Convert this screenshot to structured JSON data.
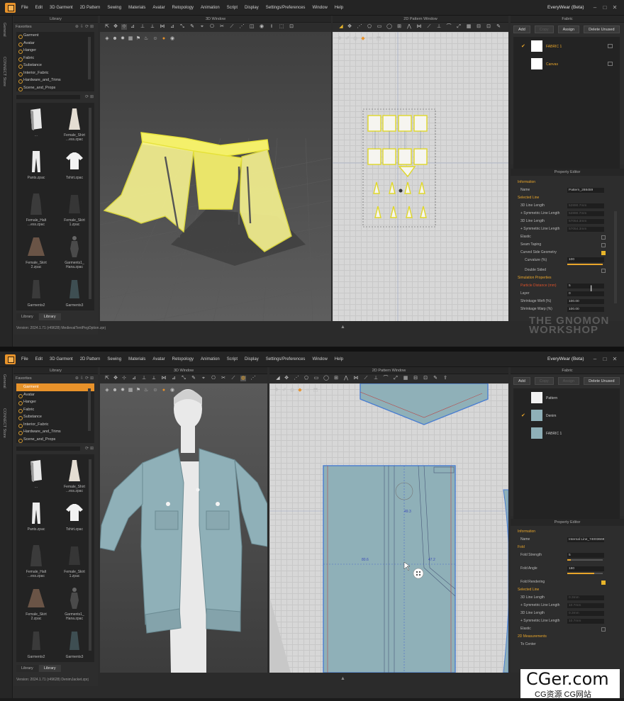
{
  "app": {
    "menu": [
      "File",
      "Edit",
      "3D Garment",
      "2D Pattern",
      "Sewing",
      "Materials",
      "Avatar",
      "Retopology",
      "Animation",
      "Script",
      "Display",
      "Settings/Preferences",
      "Window",
      "Help"
    ],
    "title": "EveryWear (Beta)",
    "side_tabs": [
      "General",
      "CONNECT Store"
    ]
  },
  "top": {
    "library_title": "Library",
    "favorites_label": "Favorites",
    "tree": [
      "Garment",
      "Avatar",
      "Hanger",
      "Fabric",
      "Substance",
      "Interior_Fabric",
      "Hardware_and_Trims",
      "Scene_and_Props"
    ],
    "items": [
      "...",
      "Female_Shirt\n...ess.zpac",
      "Pants.zpac",
      "Tshirt.zpac",
      "Female_Halt\n...ess.zpac",
      "Female_Skirt\n1.zpac",
      "Female_Skirt\n2.zpac",
      "Garments1_\nHana.zpac",
      "Garments2",
      "Garments3"
    ],
    "tabs": [
      "Library",
      "Library"
    ],
    "version": "Version: 2024.1.71 (r49628) MedievalTentPegOption.zprj",
    "window_3d_title": "3D Window",
    "window_2d_title": "2D Pattern Window",
    "fabric_title": "Fabric",
    "buttons": [
      "Add",
      "Copy",
      "Assign",
      "Delete Unused"
    ],
    "fabrics": [
      "FABRIC 1",
      "Canvas"
    ],
    "prop_title": "Property Editor",
    "props": [
      {
        "k": "Information",
        "sec": true
      },
      {
        "k": "Name",
        "v": "Pattern_288459"
      },
      {
        "k": "Selected Line",
        "sec": true
      },
      {
        "k": "3D Line Length",
        "v": "52890.7mm",
        "dim": true
      },
      {
        "k": "+ Symmetric Line Length",
        "v": "52890.7mm",
        "dim": true
      },
      {
        "k": "3D Line Length",
        "v": "57054.3mm",
        "dim": true
      },
      {
        "k": "+ Symmetric Line Length",
        "v": "57054.3mm",
        "dim": true
      },
      {
        "k": "Elastic",
        "cb": false
      },
      {
        "k": "Seam Taping",
        "cb": false
      },
      {
        "k": "Curved Side Geometry",
        "cb": true
      },
      {
        "k": "Curvature (%)",
        "v": "100",
        "slider": 100
      },
      {
        "k": "Double Sided",
        "cb": false
      },
      {
        "k": "Simulation Properties",
        "sec": true
      },
      {
        "k": "Particle Distance (mm)",
        "v": "5",
        "red": true
      },
      {
        "k": "Layer",
        "v": "0"
      },
      {
        "k": "Shrinkage Weft (%)",
        "v": "100.00"
      },
      {
        "k": "Shrinkage Warp (%)",
        "v": "100.00"
      }
    ],
    "watermark": "THE GNOMON WORKSHOP"
  },
  "bottom": {
    "library_title": "Library",
    "favorites_label": "Favorites",
    "tree": [
      "Garment",
      "Avatar",
      "Hanger",
      "Fabric",
      "Substance",
      "Interior_Fabric",
      "Hardware_and_Trims",
      "Scene_and_Props"
    ],
    "items": [
      "...",
      "Female_Shirt\n...ess.zpac",
      "Pants.zpac",
      "Tshirt.zpac",
      "Female_Halt\n...ess.zpac",
      "Female_Skirt\n1.zpac",
      "Female_Skirt\n2.zpac",
      "Garments1_\nHana.zpac",
      "Garments2",
      "Garments3"
    ],
    "tabs": [
      "Library",
      "Library"
    ],
    "version": "Version: 2024.1.71 (r49628) DenimJacket.zprj",
    "window_3d_title": "3D Window",
    "window_2d_title": "2D Pattern Window",
    "fabric_title": "Fabric",
    "buttons": [
      "Add",
      "Copy",
      "Assign",
      "Delete Unused"
    ],
    "fabrics": [
      "Pattern",
      "Denim",
      "FABRIC 1"
    ],
    "prop_title": "Property Editor",
    "props": [
      {
        "k": "Information",
        "sec": true
      },
      {
        "k": "Name",
        "v": "Internal Line_74003669"
      },
      {
        "k": "Fold",
        "sec": true
      },
      {
        "k": "Fold Strength",
        "v": "5",
        "slider": 10
      },
      {
        "k": "Fold Angle",
        "v": "180",
        "slider": 75
      },
      {
        "k": "Fold Rendering",
        "cb": true
      },
      {
        "k": "Selected Line",
        "sec": true
      },
      {
        "k": "3D Line Length",
        "v": "0.3mm",
        "dim": true
      },
      {
        "k": "+ Symmetric Line Length",
        "v": "10.7mm",
        "dim": true
      },
      {
        "k": "3D Line Length",
        "v": "0.3mm",
        "dim": true
      },
      {
        "k": "+ Symmetric Line Length",
        "v": "10.7mm",
        "dim": true
      },
      {
        "k": "Elastic",
        "cb": false
      },
      {
        "k": "2D Measurements",
        "sec": true
      },
      {
        "k": "To Center"
      }
    ],
    "measures": [
      "49.3",
      "80.6",
      "47.2"
    ]
  },
  "footer": {
    "brand": "CGer.com",
    "sub": "CG资源 CG网站"
  }
}
